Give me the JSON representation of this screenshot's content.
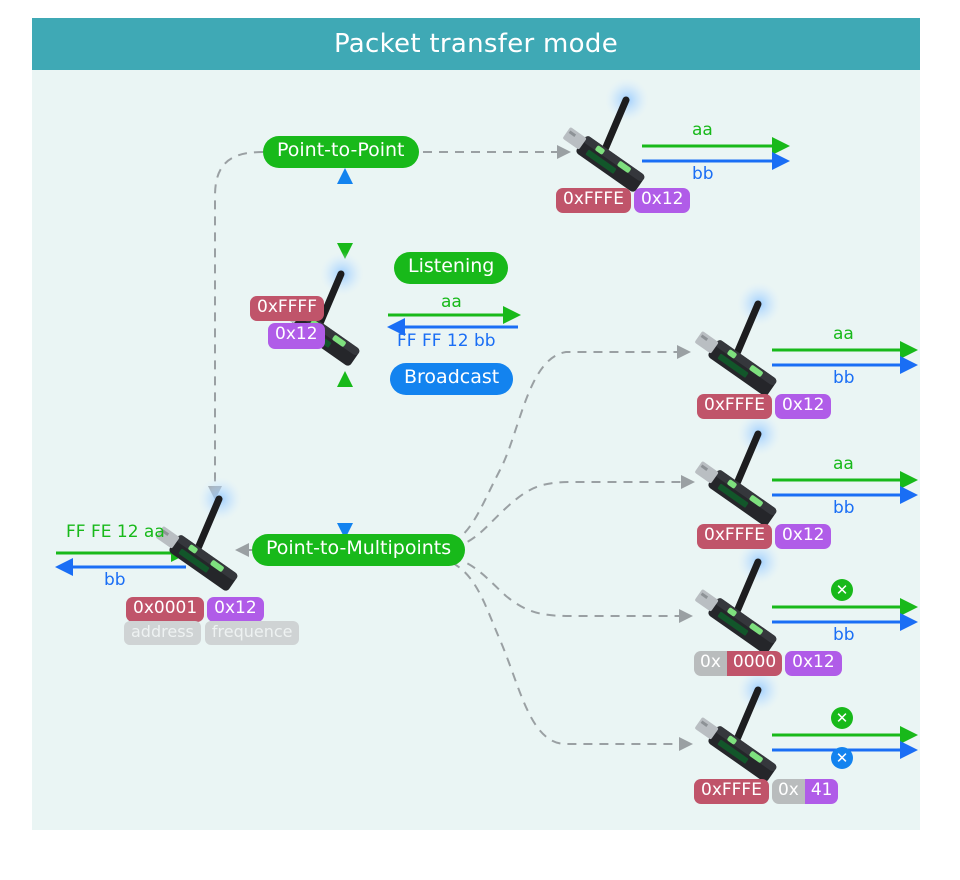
{
  "header": {
    "title": "Packet transfer mode"
  },
  "colors": {
    "header_bg": "#3fa9b5",
    "panel_bg": "#eaf5f4",
    "green": "#18b91a",
    "blue": "#1383ef",
    "red_badge": "#c0546a",
    "purple_badge": "#b05ce8",
    "gray_badge": "#b9bcbd",
    "dashed_line": "#9aa0a3"
  },
  "nodes": {
    "point_to_point": "Point-to-Point",
    "listening": "Listening",
    "broadcast": "Broadcast",
    "point_to_multipoints": "Point-to-Multipoints"
  },
  "devices": [
    {
      "id": "p2p-target",
      "tx_label": "aa",
      "rx_label": "bb",
      "tx_ok": true,
      "rx_ok": true,
      "address": "0xFFFE",
      "address_style": "red",
      "frequence": "0x12",
      "frequence_style": "purple"
    },
    {
      "id": "listening-node",
      "tx_label": "aa",
      "rx_label": "FF FF 12 bb",
      "tx_ok": true,
      "rx_ok": true,
      "address": "0xFFFF",
      "address_style": "red",
      "frequence": "0x12",
      "frequence_style": "purple"
    },
    {
      "id": "source-node",
      "tx_label": "FF FE 12 aa",
      "rx_label": "bb",
      "tx_ok": true,
      "rx_ok": true,
      "address": "0x0001",
      "address_style": "red",
      "frequence": "0x12",
      "frequence_style": "purple",
      "address_caption": "address",
      "frequence_caption": "frequence"
    },
    {
      "id": "multi-target-1",
      "tx_label": "aa",
      "rx_label": "bb",
      "tx_ok": true,
      "rx_ok": true,
      "address": "0xFFFE",
      "address_style": "red",
      "frequence": "0x12",
      "frequence_style": "purple"
    },
    {
      "id": "multi-target-2",
      "tx_label": "aa",
      "rx_label": "bb",
      "tx_ok": true,
      "rx_ok": true,
      "address": "0xFFFE",
      "address_style": "red",
      "frequence": "0x12",
      "frequence_style": "purple"
    },
    {
      "id": "multi-target-3",
      "tx_label": "",
      "rx_label": "bb",
      "tx_ok": false,
      "rx_ok": true,
      "address_prefix": "0x",
      "address_suffix": "0000",
      "address_style": "split-gray-red",
      "frequence": "0x12",
      "frequence_style": "purple"
    },
    {
      "id": "multi-target-4",
      "tx_label": "",
      "rx_label": "",
      "tx_ok": false,
      "rx_ok": false,
      "address": "0xFFFE",
      "address_style": "red",
      "frequence_prefix": "0x",
      "frequence_suffix": "41",
      "frequence_style": "split-gray-purple"
    }
  ],
  "marks": {
    "blocked": "✕"
  }
}
